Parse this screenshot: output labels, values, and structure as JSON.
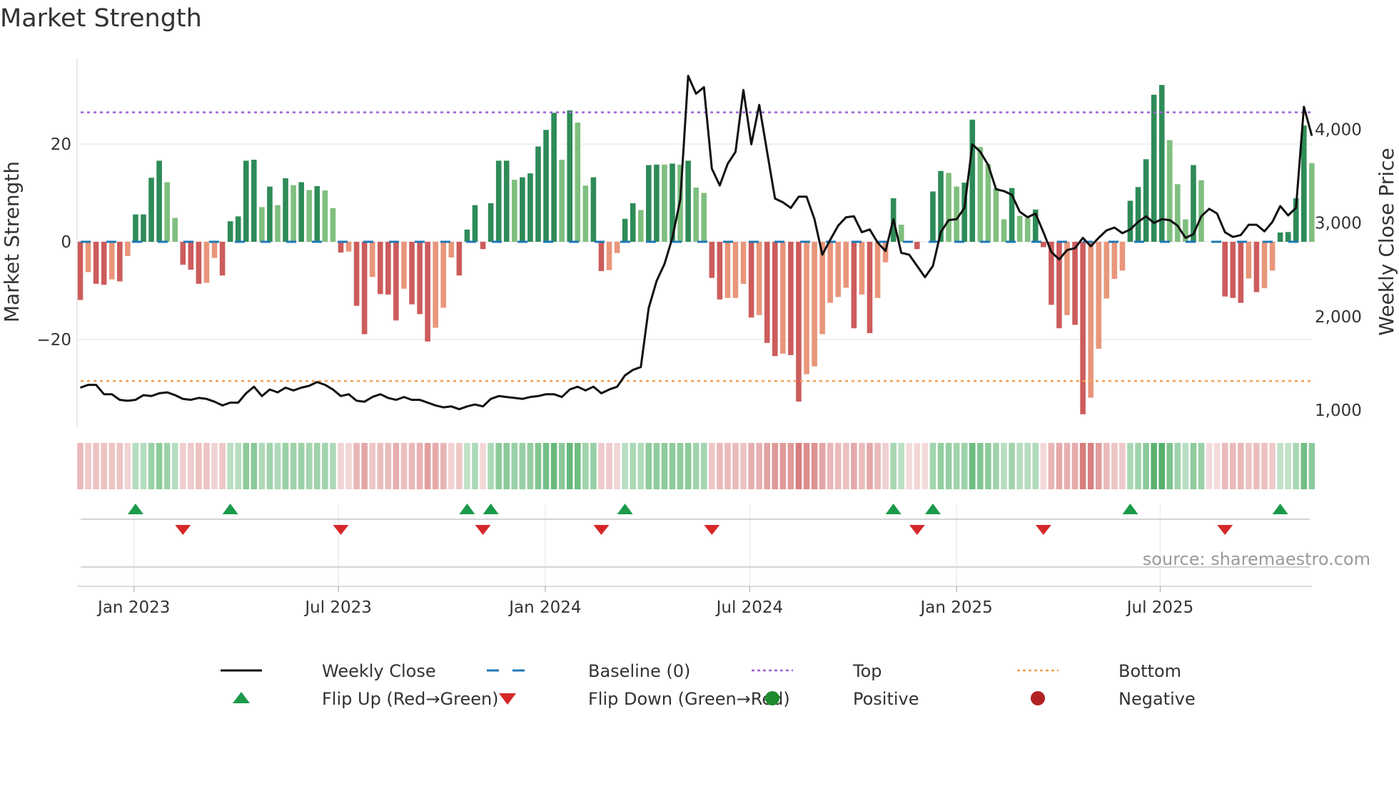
{
  "title": "Market Strength",
  "source": "source: sharemaestro.com",
  "chart_data": {
    "type": "bar",
    "title": "Market Strength",
    "ylabel": "Market Strength",
    "y2label": "Weekly Close Price",
    "ylim": [
      -38,
      38
    ],
    "y2lim": [
      800,
      4800
    ],
    "yticks": [
      {
        "v": 20,
        "label": "20"
      },
      {
        "v": 0,
        "label": "0"
      },
      {
        "v": -20,
        "label": "−20"
      }
    ],
    "y2ticks": [
      {
        "v": 4000,
        "label": "4,000"
      },
      {
        "v": 3000,
        "label": "3,000"
      },
      {
        "v": 2000,
        "label": "2,000"
      },
      {
        "v": 1000,
        "label": "1,000"
      }
    ],
    "xticks": [
      {
        "week": 6.8,
        "label": "Jan 2023"
      },
      {
        "week": 32.7,
        "label": "Jul 2023"
      },
      {
        "week": 58.9,
        "label": "Jan 2024"
      },
      {
        "week": 84.8,
        "label": "Jul 2024"
      },
      {
        "week": 111.0,
        "label": "Jan 2025"
      },
      {
        "week": 136.8,
        "label": "Jul 2025"
      }
    ],
    "top_level": 26.5,
    "bottom_level": -28.5,
    "baseline": 0,
    "strength": [
      -11.9,
      -6.2,
      -8.6,
      -8.8,
      -7.7,
      -8.1,
      -2.9,
      5.6,
      5.6,
      13.1,
      16.6,
      12.2,
      4.9,
      -4.7,
      -5.7,
      -8.6,
      -8.4,
      -3.3,
      -6.9,
      4.2,
      5.2,
      16.6,
      16.8,
      7.1,
      11.3,
      7.5,
      13.0,
      11.6,
      12.2,
      10.6,
      11.4,
      10.5,
      6.9,
      -2.2,
      -2.0,
      -13.1,
      -18.9,
      -7.2,
      -10.7,
      -10.8,
      -16.1,
      -9.6,
      -12.8,
      -14.8,
      -20.4,
      -17.6,
      -13.5,
      -3.2,
      -6.9,
      2.5,
      7.5,
      -1.5,
      7.9,
      16.6,
      16.6,
      12.7,
      13.2,
      14.0,
      19.5,
      22.9,
      26.4,
      16.8,
      26.9,
      24.4,
      11.5,
      13.2,
      -6.0,
      -5.8,
      -2.3,
      4.7,
      7.9,
      6.5,
      15.7,
      15.8,
      15.8,
      16.0,
      15.8,
      16.6,
      11.1,
      10.0,
      -7.4,
      -11.8,
      -11.5,
      -11.5,
      -8.6,
      -15.5,
      -15.0,
      -20.7,
      -23.4,
      -22.9,
      -23.2,
      -32.7,
      -27.1,
      -25.5,
      -18.9,
      -12.5,
      -11.3,
      -9.4,
      -17.7,
      -10.8,
      -18.7,
      -11.5,
      -4.2,
      8.9,
      3.5,
      0,
      -1.5,
      0,
      10.3,
      14.5,
      14.1,
      11.3,
      12.1,
      25.0,
      19.4,
      15.9,
      11.0,
      4.6,
      11.0,
      5.3,
      4.9,
      6.6,
      -1.1,
      -12.9,
      -17.7,
      -15.0,
      -17.0,
      -35.3,
      -31.9,
      -21.9,
      -11.6,
      -7.6,
      -5.9,
      8.4,
      11.2,
      16.9,
      30.1,
      32.1,
      20.8,
      11.8,
      4.6,
      15.7,
      12.6,
      0,
      0,
      -11.2,
      -11.5,
      -12.5,
      -7.5,
      -10.3,
      -9.5,
      -5.9,
      1.9,
      2.0,
      8.9,
      23.8,
      16.1
    ],
    "shade": "DLDDLDLDDDDLLDDDLLDDDDDLDLDLDLDLLDLDDLDDDLDDDLLLDDDDDDDLDDDDDLDLLDDLLDDLDDLDLDLLDDLLLDLDDLDDLLLLLLDLDLLDLDDDDDLLDDLLLLDLLDDDDLDDLLLLLDDDDDLLLDLDDDDDLDLLDDDDL",
    "weekly_close": [
      1240,
      1270,
      1270,
      1170,
      1170,
      1110,
      1100,
      1110,
      1160,
      1150,
      1180,
      1190,
      1160,
      1120,
      1110,
      1130,
      1120,
      1090,
      1050,
      1080,
      1080,
      1180,
      1250,
      1150,
      1220,
      1190,
      1240,
      1210,
      1240,
      1260,
      1300,
      1270,
      1220,
      1150,
      1170,
      1100,
      1090,
      1140,
      1170,
      1130,
      1110,
      1140,
      1110,
      1110,
      1080,
      1050,
      1030,
      1040,
      1010,
      1040,
      1060,
      1040,
      1120,
      1150,
      1140,
      1130,
      1120,
      1140,
      1150,
      1170,
      1170,
      1140,
      1220,
      1250,
      1210,
      1250,
      1180,
      1220,
      1250,
      1370,
      1430,
      1460,
      2090,
      2380,
      2560,
      2840,
      3250,
      4570,
      4380,
      4450,
      3580,
      3400,
      3630,
      3760,
      4420,
      3840,
      4260,
      3760,
      3260,
      3220,
      3160,
      3280,
      3280,
      3040,
      2660,
      2820,
      2970,
      3060,
      3070,
      2900,
      2930,
      2790,
      2700,
      3040,
      2680,
      2660,
      2540,
      2420,
      2540,
      2900,
      3030,
      3040,
      3160,
      3840,
      3760,
      3620,
      3360,
      3340,
      3300,
      3120,
      3060,
      3100,
      2900,
      2690,
      2610,
      2710,
      2730,
      2840,
      2750,
      2840,
      2920,
      2950,
      2890,
      2930,
      3010,
      3070,
      3000,
      3040,
      3030,
      2970,
      2840,
      2880,
      3070,
      3150,
      3100,
      2900,
      2850,
      2870,
      2980,
      2980,
      2910,
      3010,
      3180,
      3080,
      3160,
      4240,
      3930
    ],
    "flip_up": [
      7,
      19,
      49,
      52,
      69,
      103,
      108,
      133,
      152
    ],
    "flip_down": [
      13,
      33,
      51,
      66,
      80,
      106,
      122,
      145
    ],
    "legend_position": "bottom",
    "legend": [
      {
        "key": "close",
        "label": "Weekly Close"
      },
      {
        "key": "baseline",
        "label": "Baseline (0)"
      },
      {
        "key": "top",
        "label": "Top"
      },
      {
        "key": "bottom",
        "label": "Bottom"
      },
      {
        "key": "flipup",
        "label": "Flip Up (Red→Green)"
      },
      {
        "key": "flipdown",
        "label": "Flip Down (Green→Red)"
      },
      {
        "key": "positive",
        "label": "Positive"
      },
      {
        "key": "negative",
        "label": "Negative"
      }
    ],
    "colors": {
      "pos_strong": "#2e8b57",
      "pos_weak": "#7fbf7f",
      "neg_strong": "#cd5c5c",
      "neg_weak": "#e9967a",
      "close": "#111111",
      "baseline": "#1f77b4",
      "top": "#9b5fd6",
      "bottom": "#f0a050",
      "flip_up": "#1a9a4a",
      "flip_down": "#d62728",
      "positive": "#1e8c2e",
      "negative": "#b22222"
    }
  }
}
